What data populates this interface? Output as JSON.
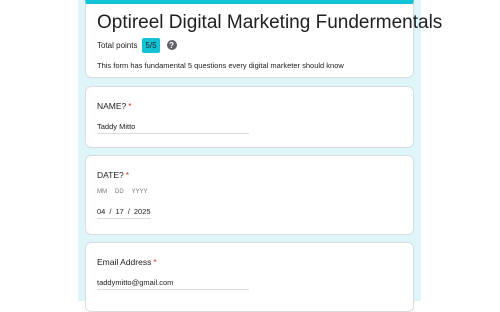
{
  "form": {
    "title": "Optireel Digital Marketing Fundermentals",
    "points_label": "Total points",
    "points_value": "5/5",
    "description": "This form has fundamental 5 questions every digital marketer should know"
  },
  "questions": [
    {
      "label": "NAME?",
      "required_mark": "*",
      "answer": "Taddy Mitto"
    },
    {
      "label": "DATE?",
      "required_mark": "*",
      "date_labels": {
        "month": "MM",
        "day": "DD",
        "year": "YYYY"
      },
      "date_value": {
        "month": "04",
        "day": "17",
        "year": "2025",
        "separator": "/"
      }
    },
    {
      "label": "Email Address",
      "required_mark": "*",
      "answer": "taddymitto@gmail.com"
    }
  ],
  "colors": {
    "accent": "#12c3d6",
    "background": "#def5f9",
    "required": "#d93025"
  },
  "icons": {
    "help": "help-circle-icon"
  }
}
